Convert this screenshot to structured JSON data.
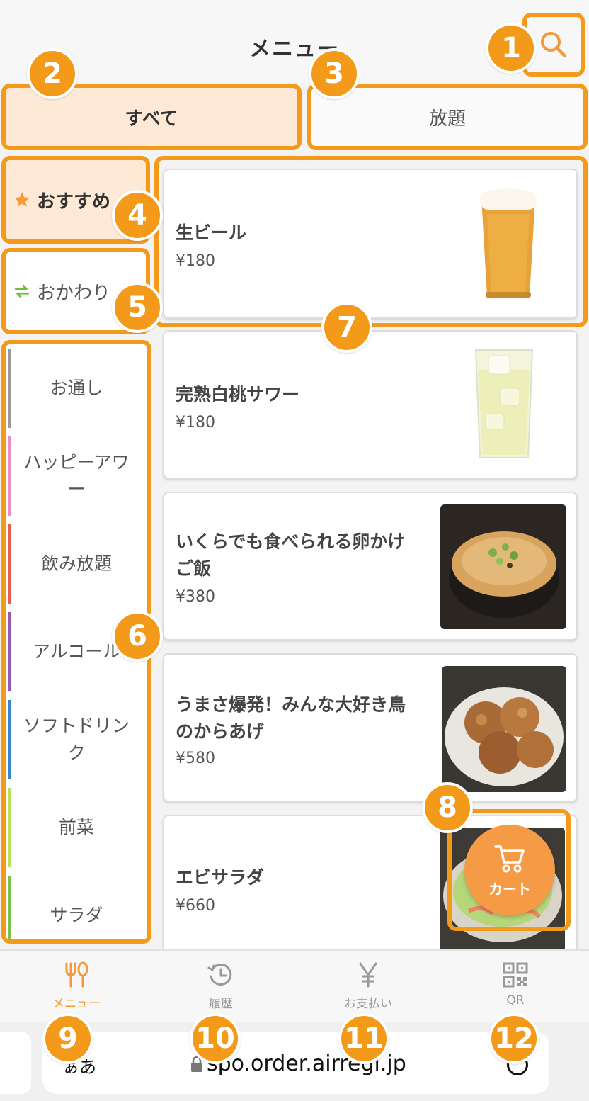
{
  "header": {
    "title": "メニュー"
  },
  "tabs": [
    {
      "label": "すべて"
    },
    {
      "label": "放題"
    }
  ],
  "sidebar": {
    "recommend_label": "おすすめ",
    "refill_label": "おかわり",
    "categories": [
      {
        "label": "お通し",
        "color": "#999999"
      },
      {
        "label": "ハッピーアワー",
        "color": "#ef8fc0"
      },
      {
        "label": "飲み放題",
        "color": "#e8604c"
      },
      {
        "label": "アルコール",
        "color": "#9b59b6"
      },
      {
        "label": "ソフトドリンク",
        "color": "#3a87c8"
      },
      {
        "label": "前菜",
        "color": "#b8e05a"
      },
      {
        "label": "サラダ",
        "color": "#7dc04a"
      }
    ]
  },
  "menu_items": [
    {
      "name": "生ビール",
      "price": "¥180",
      "image": "beer-image"
    },
    {
      "name": "完熟白桃サワー",
      "price": "¥180",
      "image": "sour-image"
    },
    {
      "name": "いくらでも食べられる卵かけご飯",
      "price": "¥380",
      "image": "egg-rice-image"
    },
    {
      "name": "うまさ爆発！みんな大好き鳥のからあげ",
      "price": "¥580",
      "image": "karaage-image"
    },
    {
      "name": "エビサラダ",
      "price": "¥660",
      "image": "shrimp-salad-image"
    }
  ],
  "cart": {
    "label": "カート"
  },
  "bottom_nav": [
    {
      "label": "メニュー",
      "icon": "fork-knife-icon"
    },
    {
      "label": "履歴",
      "icon": "history-icon"
    },
    {
      "label": "お支払い",
      "icon": "yen-icon"
    },
    {
      "label": "QR",
      "icon": "qr-icon"
    }
  ],
  "browser": {
    "text_size_label": "ぁあ",
    "url": "spo.order.airregi.jp"
  },
  "badges": [
    "1",
    "2",
    "3",
    "4",
    "5",
    "6",
    "7",
    "8",
    "9",
    "10",
    "11",
    "12"
  ],
  "colors": {
    "accent": "#f39a1a",
    "selected_bg": "#fde9d6",
    "cart": "#f59a45"
  }
}
